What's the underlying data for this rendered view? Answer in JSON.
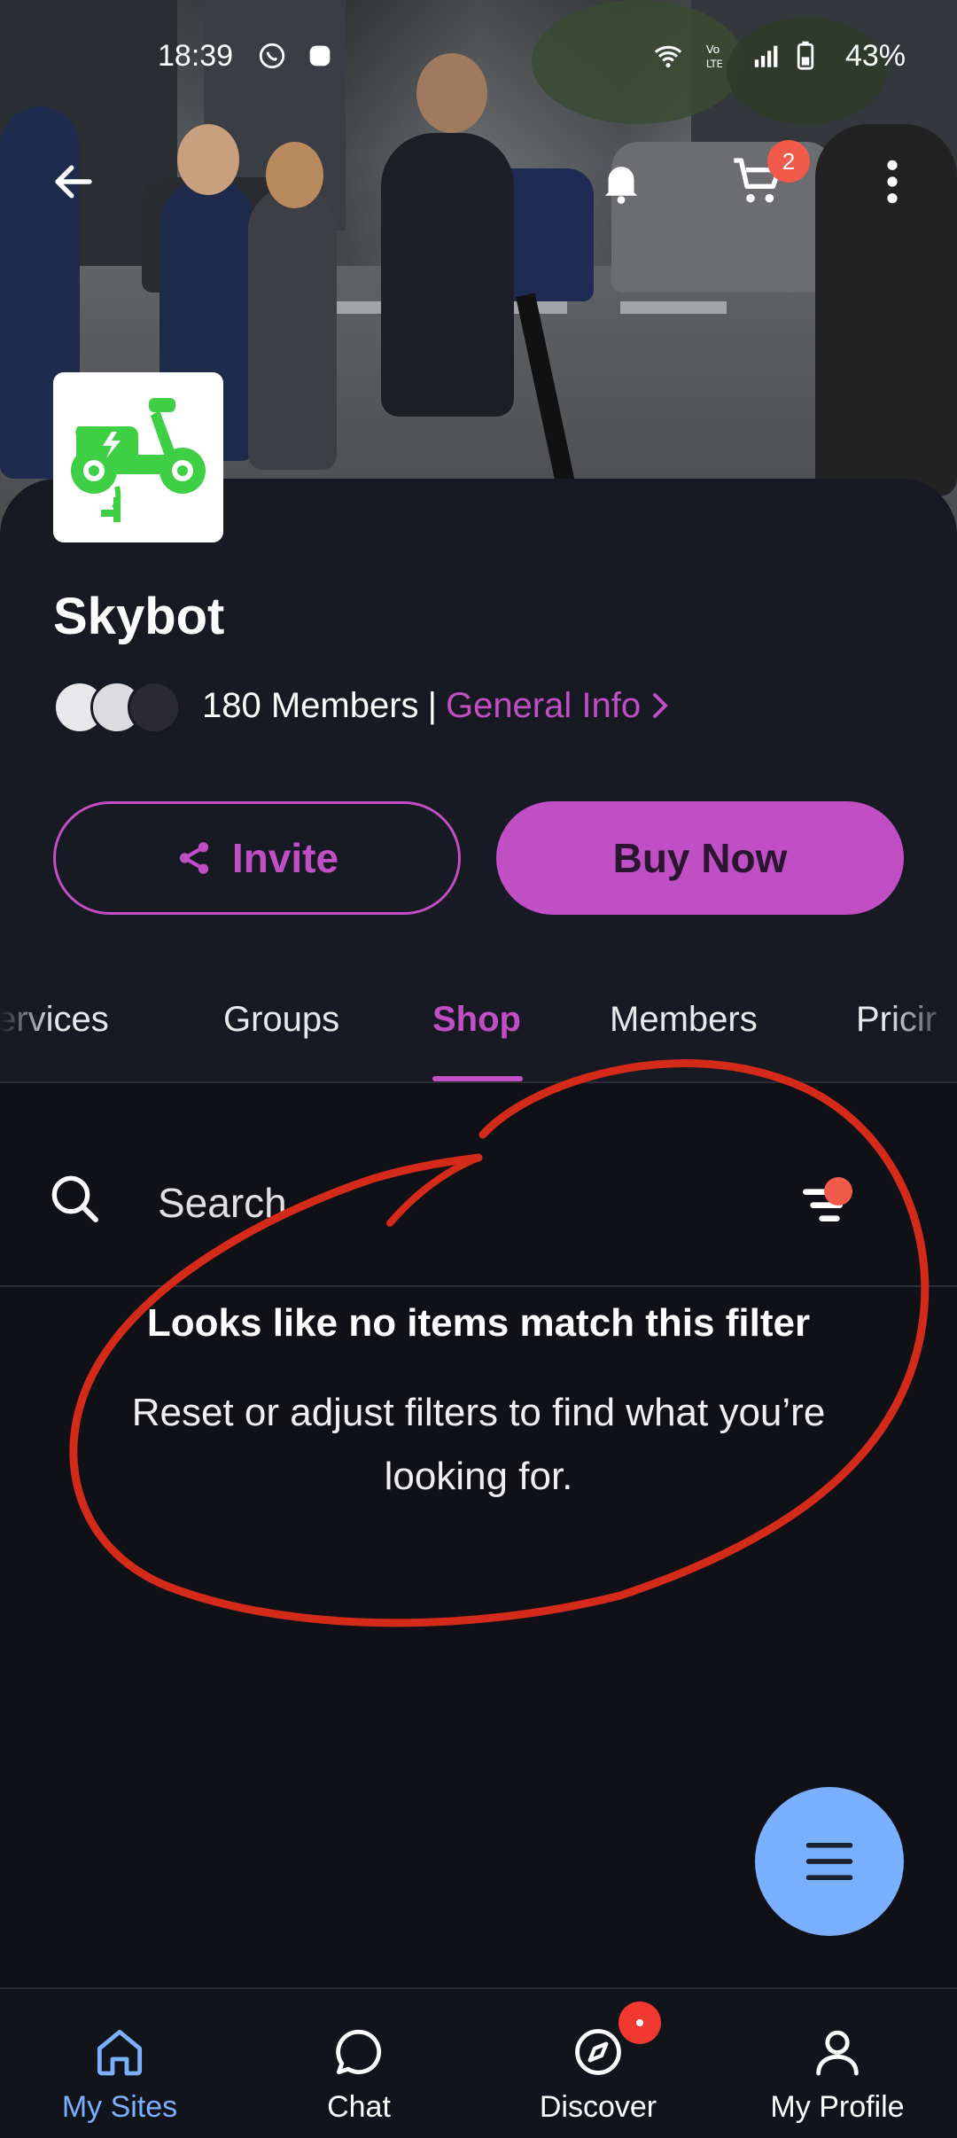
{
  "status_bar": {
    "time": "18:39",
    "battery": "43%",
    "icons": [
      "whatsapp-icon",
      "notification-icon",
      "wifi-icon",
      "volte-icon",
      "signal-icon",
      "battery-icon"
    ]
  },
  "header": {
    "back_icon": "arrow-left-icon",
    "bell_icon": "bell-icon",
    "cart_icon": "cart-icon",
    "cart_count": "2",
    "more_icon": "more-vertical-icon"
  },
  "site": {
    "name": "Skybot",
    "logo_icon": "electric-scooter-icon",
    "members_text": "180 Members",
    "separator": "|",
    "general_info_label": "General Info"
  },
  "actions": {
    "invite_label": "Invite",
    "buy_label": "Buy Now"
  },
  "tabs": [
    {
      "label": "Services",
      "visible_text": "ervices"
    },
    {
      "label": "Groups"
    },
    {
      "label": "Shop",
      "active": true
    },
    {
      "label": "Members"
    },
    {
      "label": "Pricing",
      "visible_text": "Pricir"
    }
  ],
  "shop": {
    "search_placeholder": "Search",
    "filter_active": true,
    "empty_title": "Looks like no items match this filter",
    "empty_subtitle": "Reset or adjust filters to find what you’re looking for."
  },
  "fab": {
    "icon": "menu-icon"
  },
  "bottom_nav": [
    {
      "label": "My Sites",
      "icon": "home-icon",
      "active": true
    },
    {
      "label": "Chat",
      "icon": "chat-icon"
    },
    {
      "label": "Discover",
      "icon": "compass-icon",
      "badge": true
    },
    {
      "label": "My Profile",
      "icon": "user-icon"
    }
  ],
  "colors": {
    "accent": "#c04ec4",
    "nav_active": "#7ab0ff",
    "badge": "#f25a4c",
    "annotation": "#d42a1a"
  }
}
